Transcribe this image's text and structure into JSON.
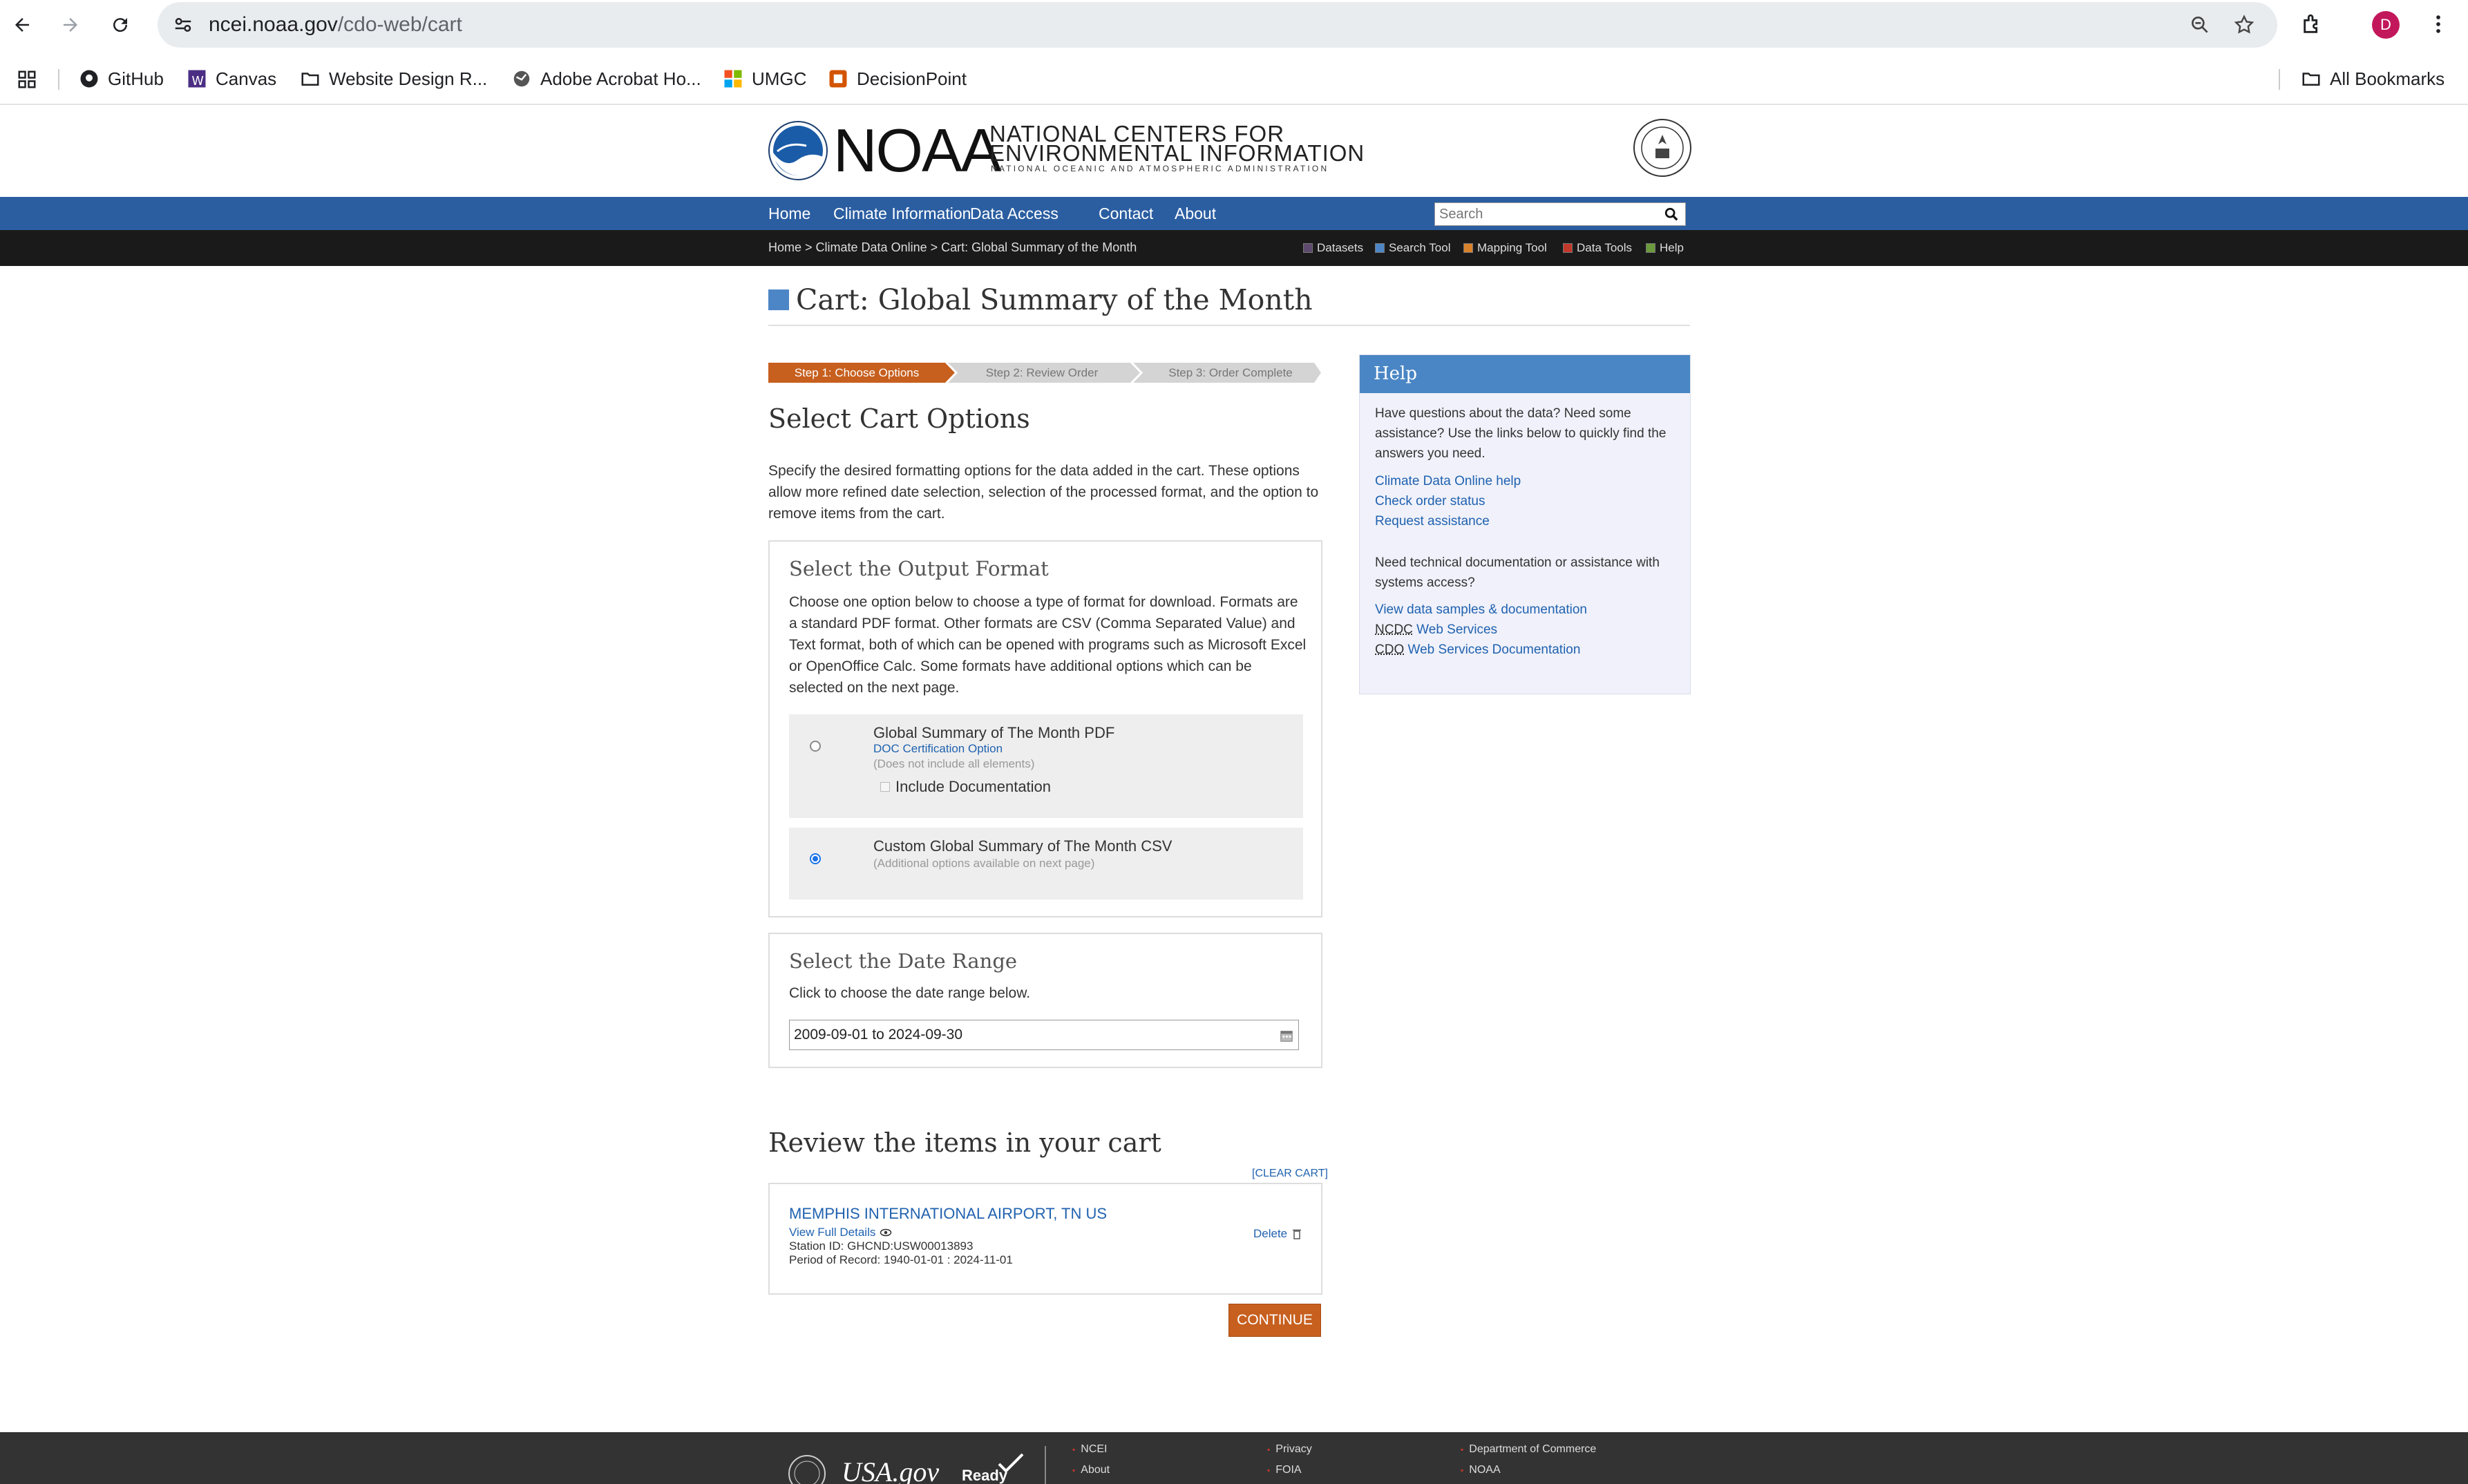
{
  "browser": {
    "url_host": "ncei.noaa.gov",
    "url_path": "/cdo-web/cart",
    "profile_initial": "D",
    "bookmarks": [
      "GitHub",
      "Canvas",
      "Website Design R...",
      "Adobe Acrobat Ho...",
      "UMGC",
      "DecisionPoint"
    ],
    "all_bookmarks": "All Bookmarks"
  },
  "header": {
    "logo_word": "NOAA",
    "logo_line1": "NATIONAL CENTERS FOR",
    "logo_line2": "ENVIRONMENTAL INFORMATION",
    "logo_line3": "NATIONAL OCEANIC AND ATMOSPHERIC ADMINISTRATION",
    "nav": [
      "Home",
      "Climate Information",
      "Data Access",
      "Contact",
      "About"
    ],
    "search_placeholder": "Search"
  },
  "breadcrumb": {
    "text": "Home > Climate Data Online > Cart: Global Summary of the Month"
  },
  "tools": [
    "Datasets",
    "Search Tool",
    "Mapping Tool",
    "Data Tools",
    "Help"
  ],
  "page": {
    "title": "Cart: Global Summary of the Month",
    "steps": [
      "Step 1: Choose Options",
      "Step 2: Review Order",
      "Step 3: Order Complete"
    ],
    "section_title": "Select Cart Options",
    "intro": "Specify the desired formatting options for the data added in the cart. These options allow more refined date selection, selection of the processed format, and the option to remove items from the cart."
  },
  "output_format": {
    "title": "Select the Output Format",
    "description": "Choose one option below to choose a type of format for download. Formats are a standard PDF format. Other formats are CSV (Comma Separated Value) and Text format, both of which can be opened with programs such as Microsoft Excel or OpenOffice Calc. Some formats have additional options which can be selected on the next page.",
    "options": [
      {
        "label": "Global Summary of The Month PDF",
        "link": "DOC Certification Option",
        "note": "(Does not include all elements)",
        "checkbox": "Include Documentation",
        "selected": false
      },
      {
        "label": "Custom Global Summary of The Month CSV",
        "note": "(Additional options available on next page)",
        "selected": true
      }
    ]
  },
  "date_range": {
    "title": "Select the Date Range",
    "hint": "Click to choose the date range below.",
    "value": "2009-09-01 to 2024-09-30"
  },
  "cart": {
    "title": "Review the items in your cart",
    "clear": "[CLEAR CART]",
    "item_name": "MEMPHIS INTERNATIONAL AIRPORT, TN US",
    "view_details": "View Full Details",
    "station_id": "Station ID: GHCND:USW00013893",
    "period": "Period of Record: 1940-01-01 : 2024-11-01",
    "delete": "Delete",
    "continue": "CONTINUE"
  },
  "help": {
    "title": "Help",
    "p1": "Have questions about the data? Need some assistance? Use the links below to quickly find the answers you need.",
    "links1": [
      "Climate Data Online help",
      "Check order status",
      "Request assistance"
    ],
    "p2": "Need technical documentation or assistance with systems access?",
    "link_samples": "View data samples & documentation",
    "ncdc_abbr": "NCDC",
    "cdo_abbr": "CDO",
    "ncdc_rest": " Web Services",
    "cdo_rest": " Web Services Documentation"
  },
  "footer": {
    "usagov": "USA.gov",
    "ready": "Ready",
    "col1": [
      "NCEI",
      "About"
    ],
    "col2": [
      "Privacy",
      "FOIA"
    ],
    "col3": [
      "Department of Commerce",
      "NOAA"
    ]
  },
  "colors": {
    "nav_blue": "#2b5ea1",
    "step_active": "#c75f1e",
    "step_inactive": "#d4d4d4",
    "help_header": "#4a86c5",
    "link": "#2062b0"
  }
}
